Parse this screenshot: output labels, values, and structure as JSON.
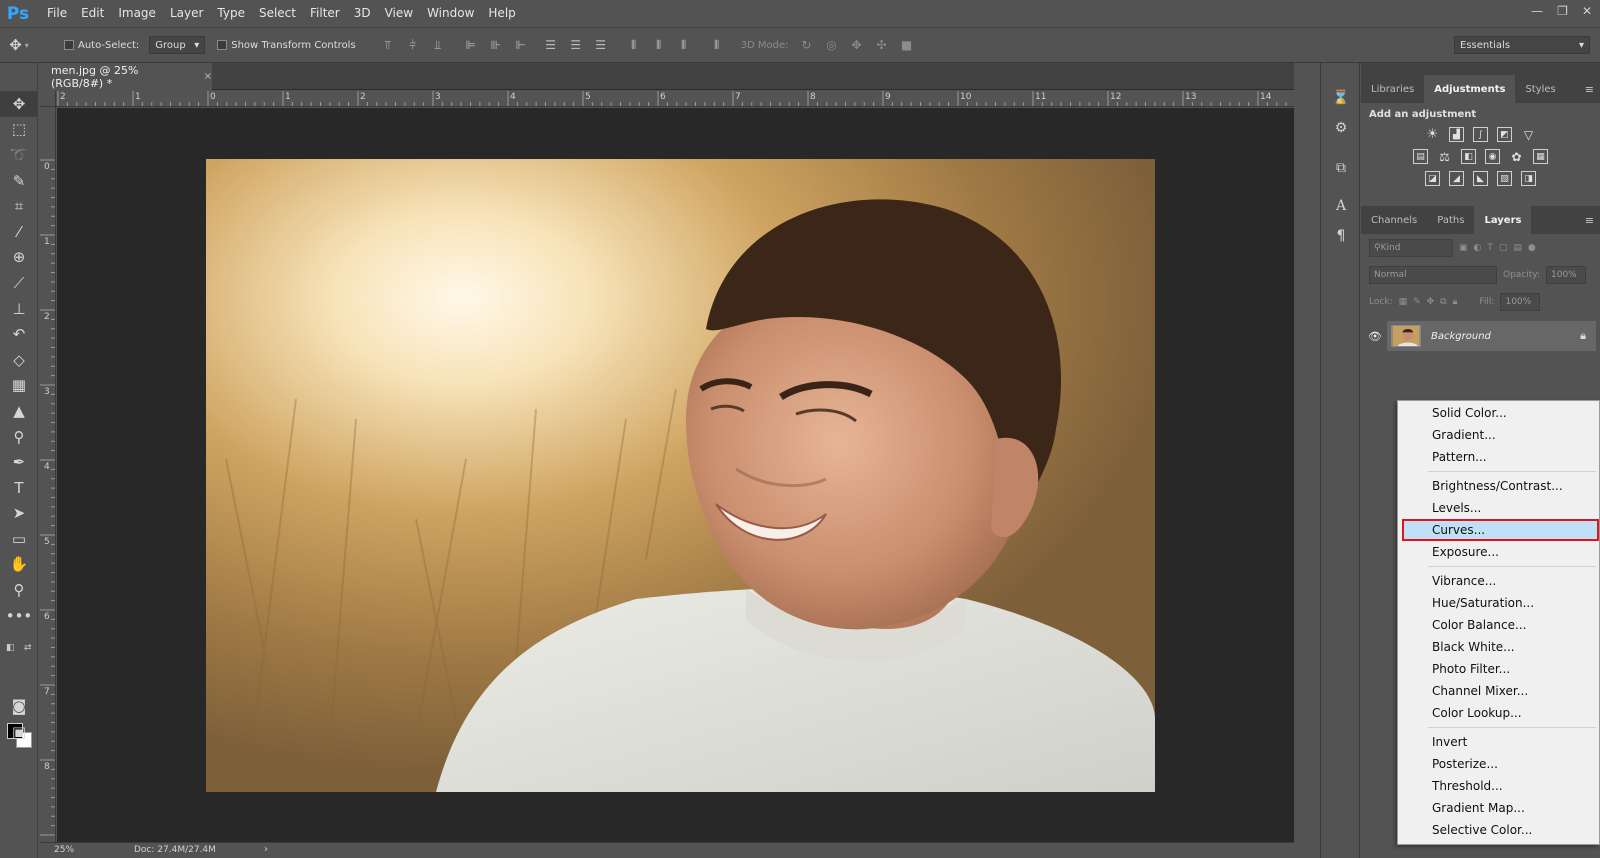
{
  "app": {
    "logo": "Ps"
  },
  "menubar": {
    "items": [
      "File",
      "Edit",
      "Image",
      "Layer",
      "Type",
      "Select",
      "Filter",
      "3D",
      "View",
      "Window",
      "Help"
    ]
  },
  "window_controls": {
    "minimize": "—",
    "restore": "❐",
    "close": "✕"
  },
  "options_bar": {
    "auto_select_label": "Auto-Select:",
    "auto_select_value": "Group",
    "show_transform_label": "Show Transform Controls",
    "mode_3d_label": "3D Mode:",
    "workspace_value": "Essentials"
  },
  "document": {
    "tab_title": "men.jpg @ 25% (RGB/8#) *",
    "tab_close": "×",
    "ruler_h": [
      "2",
      "1",
      "0",
      "1",
      "2",
      "3",
      "4",
      "5",
      "6",
      "7",
      "8",
      "9",
      "10",
      "11",
      "12",
      "13",
      "14"
    ],
    "ruler_v": [
      "0",
      "1",
      "2",
      "3",
      "4",
      "5",
      "6",
      "7",
      "8"
    ],
    "zoom_status": "25%",
    "doc_status": "Doc: 27.4M/27.4M"
  },
  "panels": {
    "top_tabs": [
      "Libraries",
      "Adjustments",
      "Styles"
    ],
    "top_active": "Adjustments",
    "adjustments_title": "Add an adjustment",
    "bottom_tabs": [
      "Channels",
      "Paths",
      "Layers"
    ],
    "bottom_active": "Layers",
    "kind_placeholder": "Kind",
    "blend_mode": "Normal",
    "opacity_label": "Opacity:",
    "opacity_value": "100%",
    "lock_label": "Lock:",
    "fill_label": "Fill:",
    "fill_value": "100%",
    "background_layer": "Background"
  },
  "context_menu": {
    "items": [
      "Solid Color...",
      "Gradient...",
      "Pattern...",
      "Brightness/Contrast...",
      "Levels...",
      "Curves...",
      "Exposure...",
      "Vibrance...",
      "Hue/Saturation...",
      "Color Balance...",
      "Black  White...",
      "Photo Filter...",
      "Channel Mixer...",
      "Color Lookup...",
      "Invert",
      "Posterize...",
      "Threshold...",
      "Gradient Map...",
      "Selective Color..."
    ],
    "highlighted": "Curves...",
    "highlight_border_color": "#e0141c",
    "highlight_fill_color": "#bfe0f7"
  },
  "colors": {
    "ui_bg": "#535353",
    "canvas_bg": "#282828",
    "logo_blue": "#31a8ff"
  }
}
